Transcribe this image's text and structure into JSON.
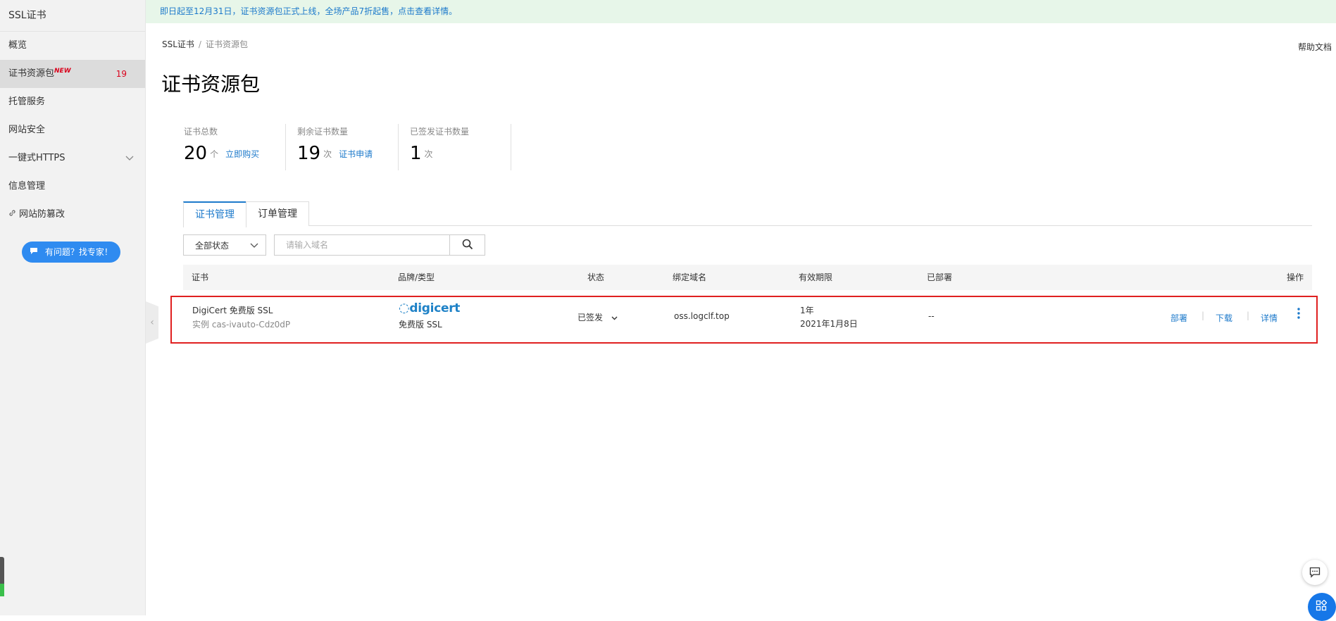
{
  "sidebar": {
    "title": "SSL证书",
    "items": [
      {
        "label": "概览"
      },
      {
        "label": "证书资源包",
        "badge": "NEW",
        "count": "19"
      },
      {
        "label": "托管服务"
      },
      {
        "label": "网站安全"
      },
      {
        "label": "一键式HTTPS"
      },
      {
        "label": "信息管理"
      },
      {
        "label": "网站防篡改"
      }
    ],
    "help_button": "有问题？找专家！"
  },
  "banner": {
    "text": "即日起至12月31日，证书资源包正式上线，全场产品7折起售，点击查看详情。"
  },
  "breadcrumb": {
    "root": "SSL证书",
    "sep": "/",
    "current": "证书资源包"
  },
  "help_doc": "帮助文档",
  "page_title": "证书资源包",
  "stats": [
    {
      "label": "证书总数",
      "value": "20",
      "unit": "个",
      "link": "立即购买"
    },
    {
      "label": "剩余证书数量",
      "value": "19",
      "unit": "次",
      "link": "证书申请"
    },
    {
      "label": "已签发证书数量",
      "value": "1",
      "unit": "次"
    }
  ],
  "tabs": [
    {
      "label": "证书管理"
    },
    {
      "label": "订单管理"
    }
  ],
  "filter": {
    "status_selected": "全部状态",
    "search_placeholder": "请输入域名"
  },
  "table": {
    "columns": {
      "cert": "证书",
      "brand": "品牌/类型",
      "status": "状态",
      "domain": "绑定域名",
      "validity": "有效期限",
      "deployed": "已部署",
      "ops": "操作"
    },
    "rows": [
      {
        "cert_name": "DigiCert 免费版 SSL",
        "instance": "实例 cas-ivauto-Cdz0dP",
        "brand_logo": "digicert",
        "brand_type": "免费版 SSL",
        "status": "已签发",
        "domain": "oss.logclf.top",
        "validity_period": "1年",
        "validity_date": "2021年1月8日",
        "deployed": "--",
        "actions": {
          "deploy": "部署",
          "download": "下载",
          "detail": "详情"
        }
      }
    ]
  },
  "colors": {
    "accent": "#1d7acb",
    "highlight_border": "#e02020",
    "banner_bg": "#e7f6e9",
    "help_button_bg": "#2f8bf0"
  }
}
